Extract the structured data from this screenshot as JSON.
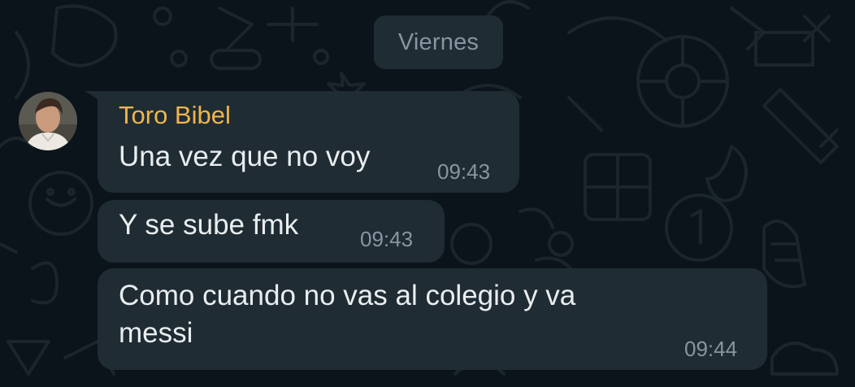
{
  "chat": {
    "date_separator": "Viernes",
    "colors": {
      "background": "#0b141a",
      "bubble": "#1f2c34",
      "sender_name": "#f0b54a",
      "message_text": "#e9edef",
      "meta_text": "#8696a0"
    },
    "messages": [
      {
        "sender": "Toro Bibel",
        "text": "Una vez que no voy",
        "time": "09:43",
        "avatar_icon": "user-avatar"
      },
      {
        "text": "Y se sube fmk",
        "time": "09:43"
      },
      {
        "text_lines": [
          "Como cuando no vas al colegio y va",
          "messi"
        ],
        "time": "09:44"
      }
    ]
  }
}
